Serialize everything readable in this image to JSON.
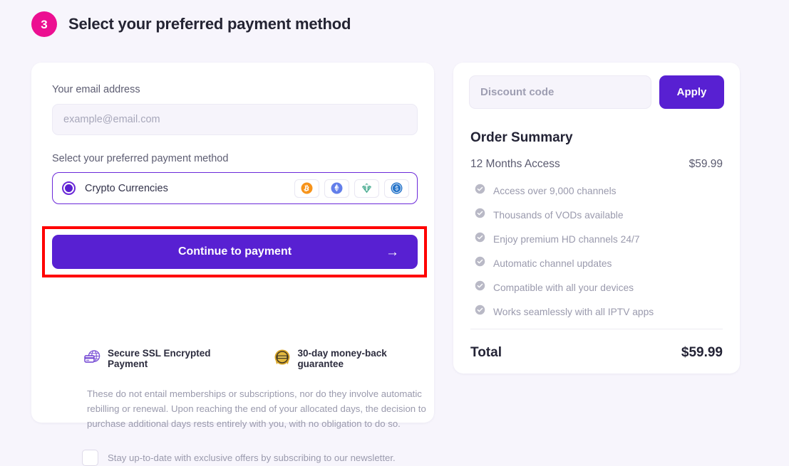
{
  "step": {
    "number": "3",
    "title": "Select your preferred payment method",
    "badge_color": "#ec0f91"
  },
  "checkout": {
    "email_label": "Your email address",
    "email_value": "",
    "email_placeholder": "example@email.com",
    "method_label": "Select your preferred payment method",
    "method": {
      "name": "Crypto Currencies",
      "selected": true,
      "coins": [
        {
          "name": "bitcoin-icon",
          "symbol": "B",
          "color": "#f7931a"
        },
        {
          "name": "ethereum-icon",
          "symbol": "E",
          "color": "#627eea"
        },
        {
          "name": "tether-icon",
          "symbol": "T",
          "color": "#50af95"
        },
        {
          "name": "usdc-icon",
          "symbol": "$",
          "color": "#2775ca"
        }
      ]
    },
    "cta_label": "Continue to payment",
    "cta_arrow": "→",
    "cta_color": "#5820d2",
    "highlight_color": "#ff0000",
    "trust": [
      {
        "icon": "ssl-globe-card-icon",
        "text": "Secure SSL Encrypted Payment"
      },
      {
        "icon": "money-back-seal-icon",
        "text": "30-day money-back guarantee"
      }
    ],
    "disclaimer": "These do not entail memberships or subscriptions, nor do they involve automatic rebilling or renewal. Upon reaching the end of your allocated days, the decision to purchase additional days rests entirely with you, with no obligation to do so.",
    "newsletter_label": "Stay up-to-date with exclusive offers by subscribing to our newsletter.",
    "newsletter_checked": false
  },
  "summary": {
    "discount_value": "",
    "discount_placeholder": "Discount code",
    "apply_label": "Apply",
    "title": "Order Summary",
    "plan_name": "12 Months Access",
    "plan_price": "$59.99",
    "features": [
      "Access over 9,000 channels",
      "Thousands of VODs available",
      "Enjoy premium HD channels 24/7",
      "Automatic channel updates",
      "Compatible with all your devices",
      "Works seamlessly with all IPTV apps"
    ],
    "total_label": "Total",
    "total_value": "$59.99"
  }
}
